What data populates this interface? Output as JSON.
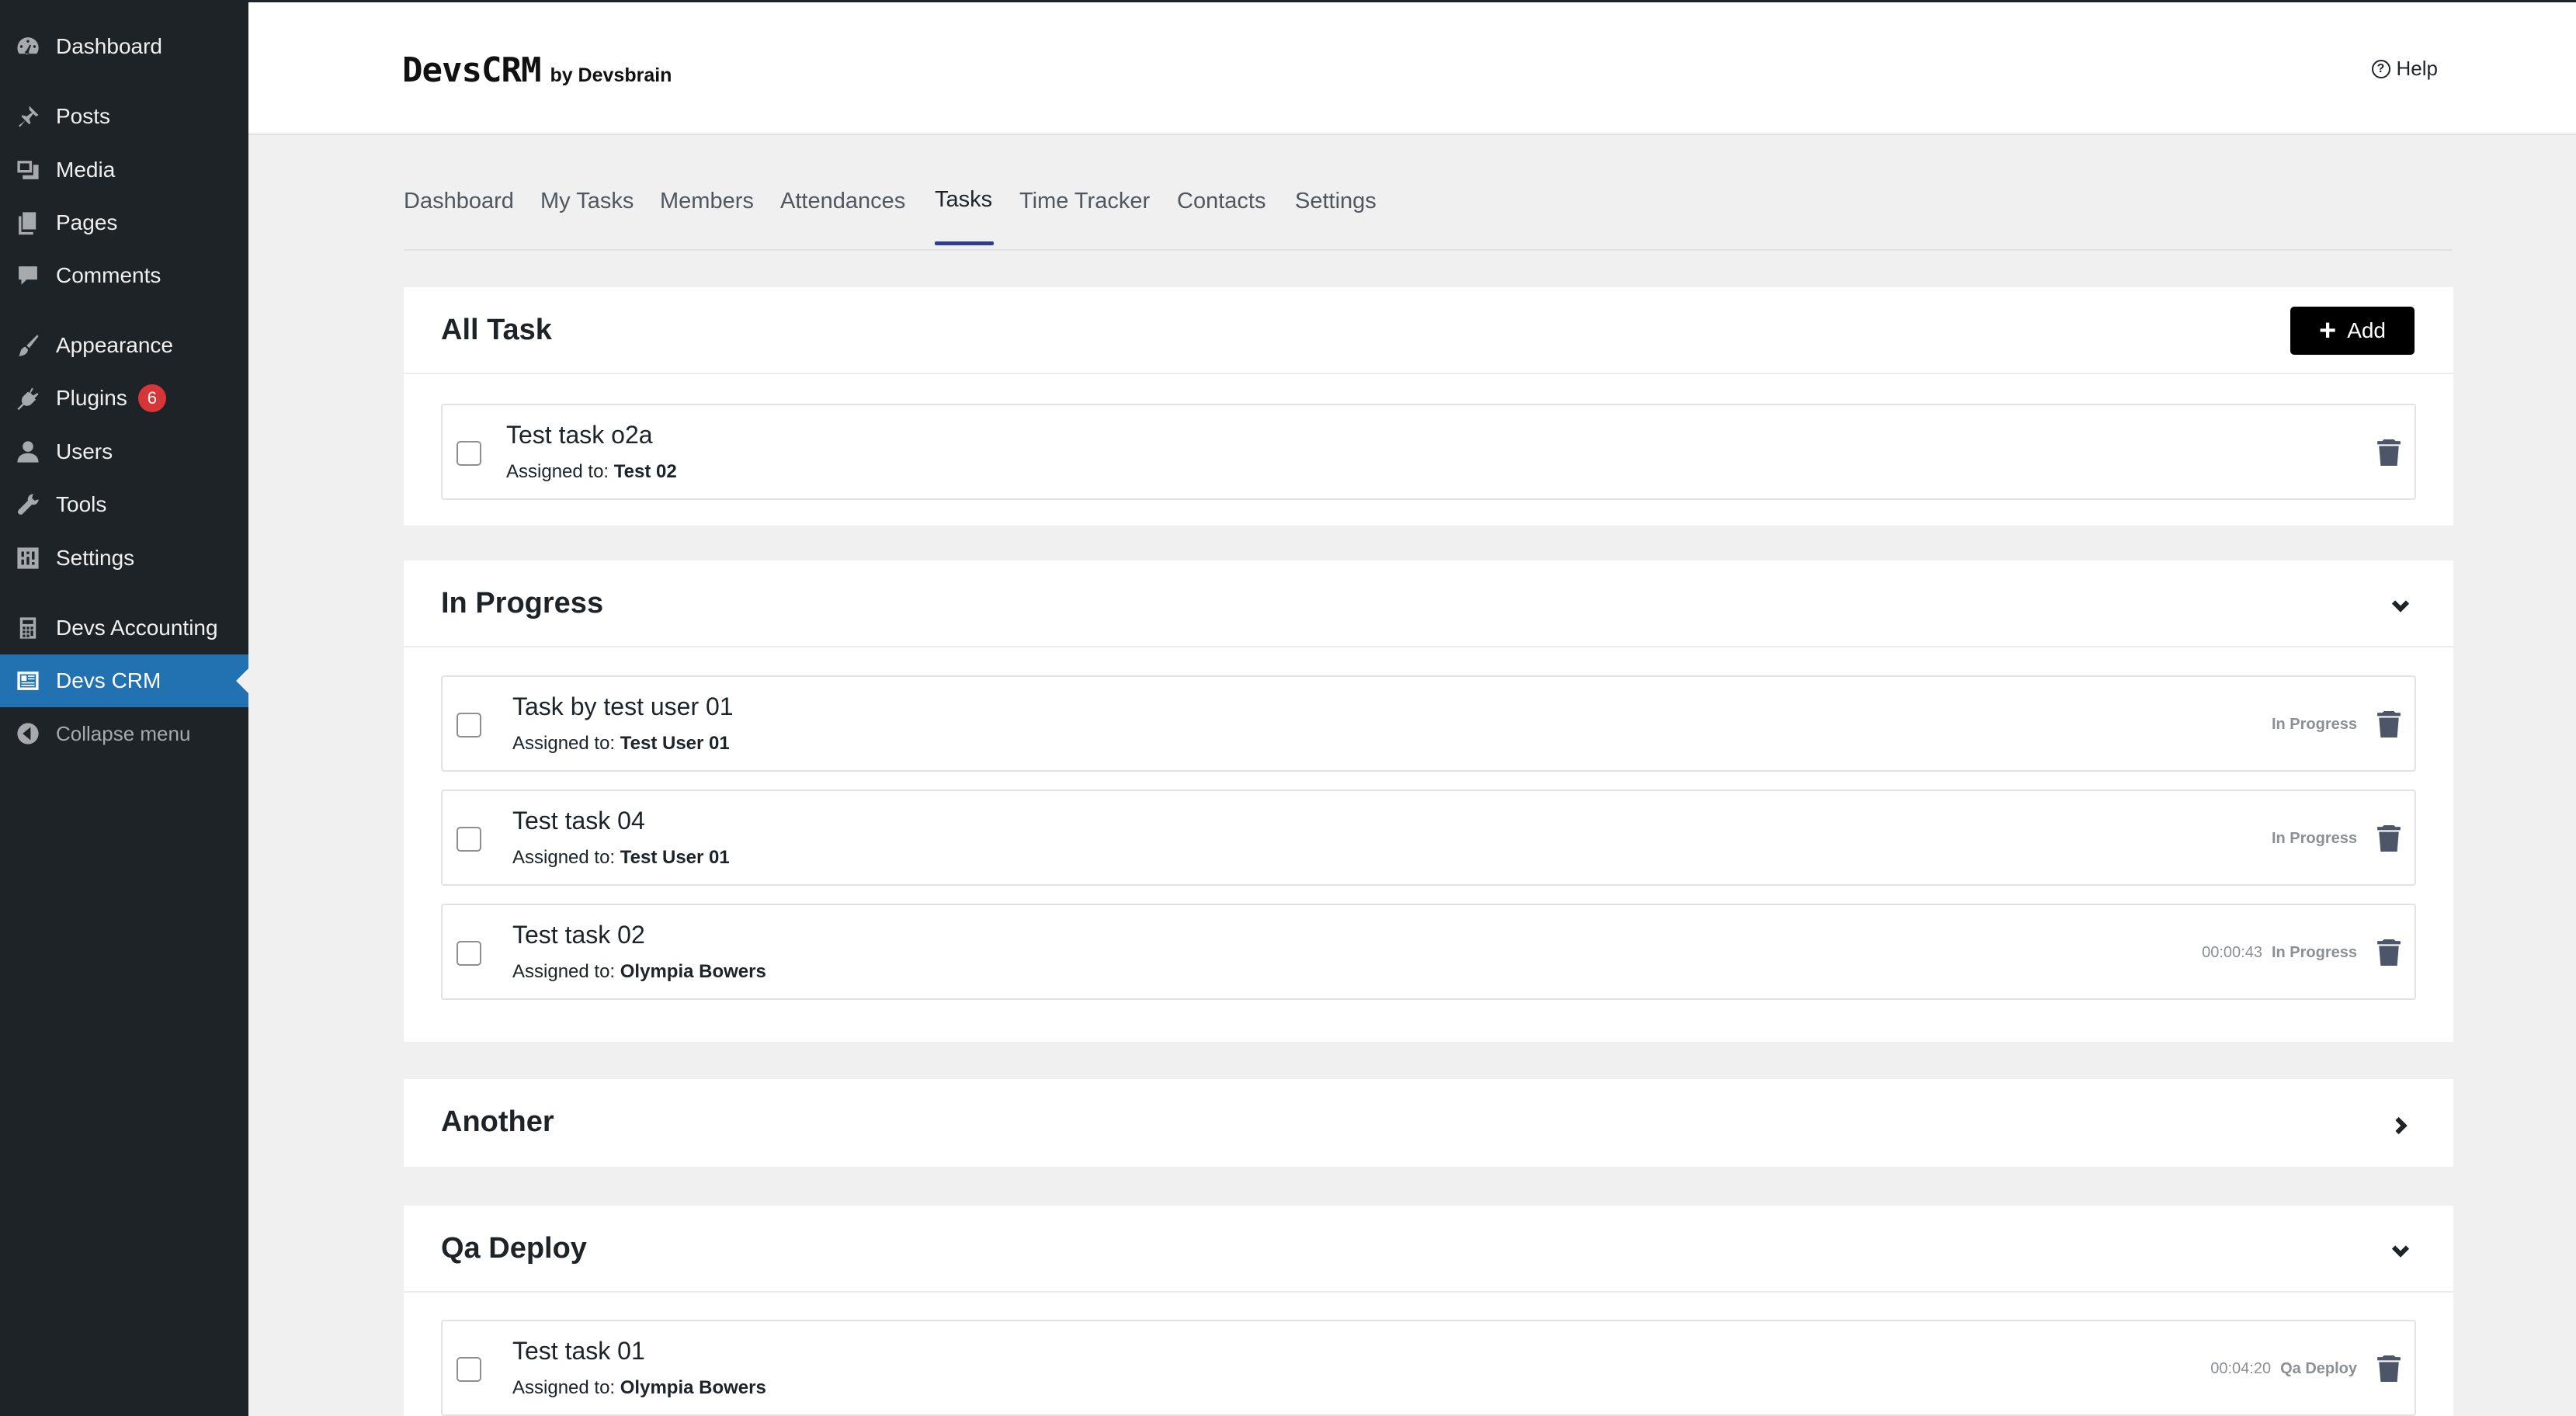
{
  "sidebar": {
    "items": [
      {
        "label": "Dashboard",
        "icon": "dashboard-icon"
      },
      {
        "label": "Posts",
        "icon": "pin-icon"
      },
      {
        "label": "Media",
        "icon": "media-icon"
      },
      {
        "label": "Pages",
        "icon": "pages-icon"
      },
      {
        "label": "Comments",
        "icon": "comment-icon"
      },
      {
        "label": "Appearance",
        "icon": "brush-icon"
      },
      {
        "label": "Plugins",
        "icon": "plugin-icon",
        "badge": "6"
      },
      {
        "label": "Users",
        "icon": "user-icon"
      },
      {
        "label": "Tools",
        "icon": "wrench-icon"
      },
      {
        "label": "Settings",
        "icon": "settings-icon"
      },
      {
        "label": "Devs Accounting",
        "icon": "calculator-icon"
      },
      {
        "label": "Devs CRM",
        "icon": "crm-icon"
      },
      {
        "label": "Collapse menu",
        "icon": "collapse-icon"
      }
    ]
  },
  "header": {
    "brand": "DevsCRM",
    "brand_sub": "by Devsbrain",
    "help_label": "Help"
  },
  "tabs": [
    {
      "label": "Dashboard"
    },
    {
      "label": "My Tasks"
    },
    {
      "label": "Members"
    },
    {
      "label": "Attendances"
    },
    {
      "label": "Tasks"
    },
    {
      "label": "Time Tracker"
    },
    {
      "label": "Contacts"
    },
    {
      "label": "Settings"
    }
  ],
  "active_tab": "Tasks",
  "sections": {
    "all": {
      "title": "All Task",
      "add_label": "Add",
      "tasks": [
        {
          "title": "Test task o2a",
          "assigned_label": "Assigned to:",
          "assignee": "Test 02"
        }
      ]
    },
    "in_progress": {
      "title": "In Progress",
      "tasks": [
        {
          "title": "Task by test user 01",
          "assigned_label": "Assigned to:",
          "assignee": "Test User 01",
          "time": "",
          "status": "In Progress"
        },
        {
          "title": "Test task 04",
          "assigned_label": "Assigned to:",
          "assignee": "Test User 01",
          "time": "",
          "status": "In Progress"
        },
        {
          "title": "Test task 02",
          "assigned_label": "Assigned to:",
          "assignee": "Olympia Bowers",
          "time": "00:00:43",
          "status": "In Progress"
        }
      ]
    },
    "another": {
      "title": "Another"
    },
    "qa_deploy": {
      "title": "Qa Deploy",
      "tasks": [
        {
          "title": "Test task 01",
          "assigned_label": "Assigned to:",
          "assignee": "Olympia Bowers",
          "time": "00:04:20",
          "status": "Qa Deploy"
        }
      ]
    }
  },
  "colors": {
    "sidebar_bg": "#1d2327",
    "active_menu": "#2271b1",
    "badge": "#d63638",
    "tab_underline": "#2c3e8c",
    "add_button": "#000000"
  }
}
